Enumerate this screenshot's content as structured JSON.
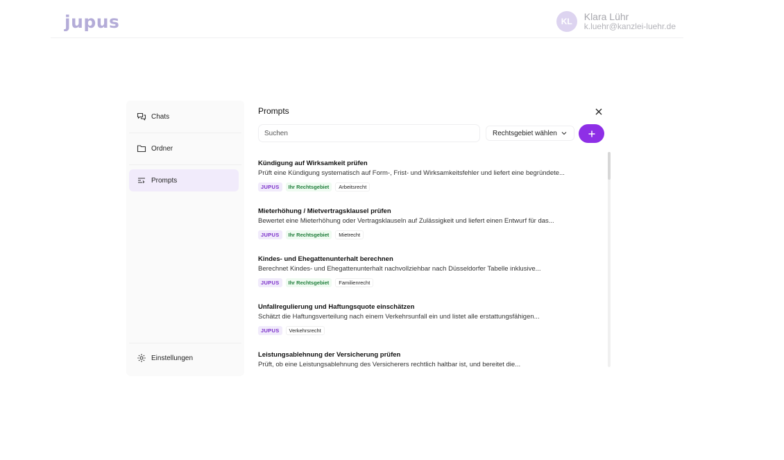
{
  "brand": {
    "logo": "jupus"
  },
  "user": {
    "initials": "KL",
    "name": "Klara Lühr",
    "email": "k.luehr@kanzlei-luehr.de"
  },
  "sidebar": {
    "items": [
      {
        "label": "Chats",
        "icon": "chat-icon"
      },
      {
        "label": "Ordner",
        "icon": "folder-icon"
      },
      {
        "label": "Prompts",
        "icon": "prompts-icon",
        "active": true
      }
    ],
    "settings": {
      "label": "Einstellungen",
      "icon": "gear-icon"
    }
  },
  "panel": {
    "title": "Prompts",
    "search": {
      "placeholder": "Suchen",
      "value": ""
    },
    "filter": {
      "label": "Rechtsgebiet wählen"
    },
    "prompts": [
      {
        "title": "Kündigung auf Wirksamkeit prüfen",
        "description": "Prüft eine Kündigung systematisch auf Form-, Frist- und Wirksamkeitsfehler und liefert eine begründete...",
        "tags": {
          "source": "JUPUS",
          "area": "Ihr Rechtsgebiet",
          "category": "Arbeitsrecht"
        }
      },
      {
        "title": "Mieterhöhung / Mietvertragsklausel prüfen",
        "description": "Bewertet eine Mieterhöhung oder Vertragsklauseln auf Zulässigkeit und liefert einen Entwurf für das...",
        "tags": {
          "source": "JUPUS",
          "area": "Ihr Rechtsgebiet",
          "category": "Mietrecht"
        }
      },
      {
        "title": "Kindes- und Ehegattenunterhalt berechnen",
        "description": "Berechnet Kindes- und Ehegattenunterhalt nachvollziehbar nach Düsseldorfer Tabelle inklusive...",
        "tags": {
          "source": "JUPUS",
          "area": "Ihr Rechtsgebiet",
          "category": "Familienrecht"
        }
      },
      {
        "title": "Unfallregulierung und Haftungsquote einschätzen",
        "description": "Schätzt die Haftungsverteilung nach einem Verkehrsunfall ein und listet alle erstattungsfähigen...",
        "tags": {
          "source": "JUPUS",
          "category": "Verkehrsrecht"
        }
      },
      {
        "title": "Leistungsablehnung der Versicherung prüfen",
        "description": "Prüft, ob eine Leistungsablehnung des Versicherers rechtlich haltbar ist, und bereitet die...",
        "tags": {}
      }
    ]
  },
  "colors": {
    "accent": "#8e2fe6",
    "active_bg": "#f1ebfb",
    "area_tag": "#1f7d3a"
  }
}
